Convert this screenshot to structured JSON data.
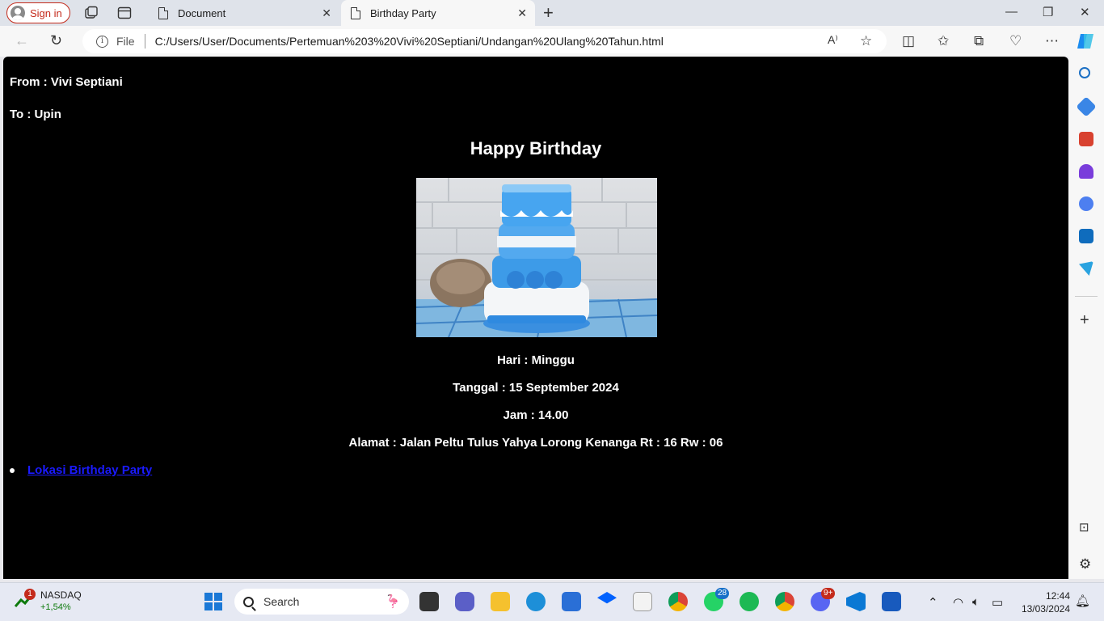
{
  "browser": {
    "sign_in_label": "Sign in",
    "tabs": [
      {
        "title": "Document"
      },
      {
        "title": "Birthday Party"
      }
    ],
    "address": {
      "scheme_label": "File",
      "url": "C:/Users/User/Documents/Pertemuan%203%20Vivi%20Septiani/Undangan%20Ulang%20Tahun.html"
    }
  },
  "page": {
    "from": "From : Vivi Septiani",
    "to": "To : Upin",
    "heading": "Happy Birthday",
    "hari": "Hari : Minggu",
    "tanggal": "Tanggal : 15 September 2024",
    "jam": "Jam : 14.00",
    "alamat": "Alamat : Jalan Peltu Tulus Yahya Lorong Kenanga Rt : 16 Rw : 06",
    "link_label": "Lokasi Birthday Party",
    "link_color": "#1a1aff",
    "background": "#000000"
  },
  "taskbar": {
    "stock_name": "NASDAQ",
    "stock_change": "+1,54%",
    "stock_badge": "1",
    "search_label": "Search",
    "whatsapp_badge": "28",
    "discord_badge": "9+",
    "time": "12:44",
    "date": "13/03/2024"
  }
}
